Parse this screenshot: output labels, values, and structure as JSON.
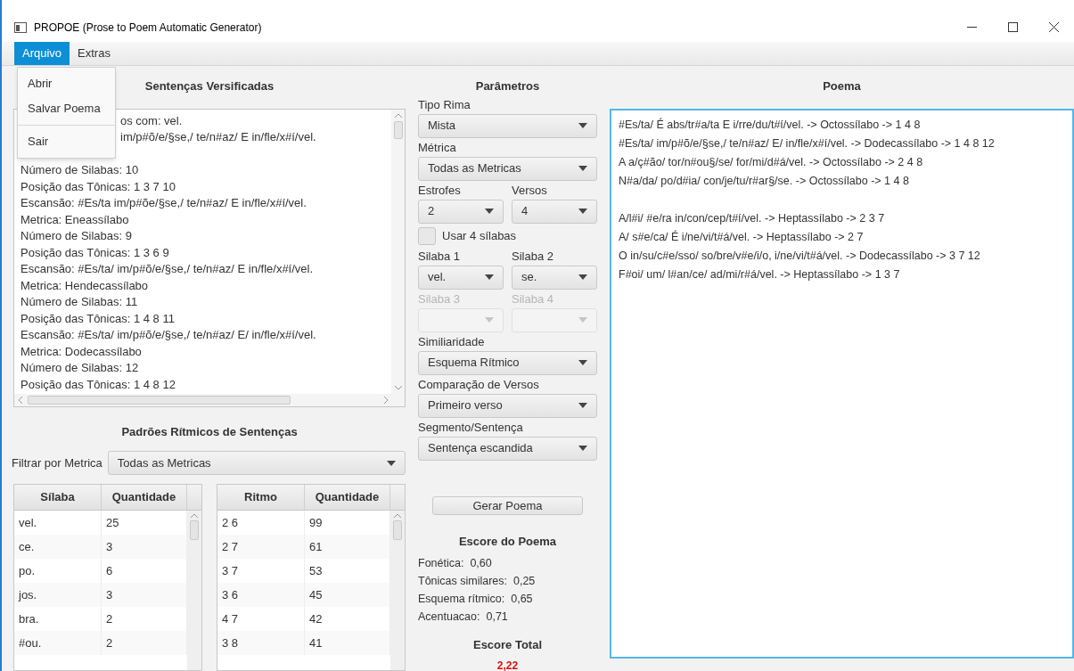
{
  "window": {
    "title": "PROPOE (Prose to Poem Automatic Generator)"
  },
  "menu_bar": [
    {
      "label": "Arquivo",
      "selected": true
    },
    {
      "label": "Extras",
      "selected": false
    }
  ],
  "open_menu": {
    "items": [
      {
        "kind": "item",
        "label": "Abrir"
      },
      {
        "kind": "item",
        "label": "Salvar Poema"
      },
      {
        "kind": "separator"
      },
      {
        "kind": "item",
        "label": "Sair"
      }
    ]
  },
  "verified_sentences": {
    "title": "Sentenças Versificadas",
    "lines": [
      {
        "kind": "partial",
        "text": "os com: vel."
      },
      {
        "kind": "partial",
        "text": "im/p#õ/e/§se,/ te/n#az/ E in/fle/x#í/vel."
      },
      {
        "kind": "covered"
      },
      {
        "kind": "full",
        "text": "Número de Silabas: 10"
      },
      {
        "kind": "full",
        "text": "Posição das Tônicas: 1 3 7 10"
      },
      {
        "kind": "full",
        "text": "Escansão: #Es/ta im/p#õe/§se,/ te/n#az/ E in/fle/x#í/vel."
      },
      {
        "kind": "full",
        "text": "Metrica: Eneassílabo"
      },
      {
        "kind": "full",
        "text": "Número de Silabas: 9"
      },
      {
        "kind": "full",
        "text": "Posição das Tônicas: 1 3 6 9"
      },
      {
        "kind": "full",
        "text": "Escansão: #Es/ta/ im/p#õ/e/§se,/ te/n#az/ E in/fle/x#í/vel."
      },
      {
        "kind": "full",
        "text": "Metrica: Hendecassílabo"
      },
      {
        "kind": "full",
        "text": "Número de Silabas: 11"
      },
      {
        "kind": "full",
        "text": "Posição das Tônicas: 1 4 8 11"
      },
      {
        "kind": "full",
        "text": "Escansão: #Es/ta/ im/p#õ/e/§se,/ te/n#az/ E/ in/fle/x#í/vel."
      },
      {
        "kind": "full",
        "text": "Metrica: Dodecassílabo"
      },
      {
        "kind": "full",
        "text": "Número de Silabas: 12"
      },
      {
        "kind": "full",
        "text": "Posição das Tônicas: 1 4 8 12"
      }
    ]
  },
  "rhythm_patterns": {
    "title": "Padrões Rítmicos de Sentenças",
    "filter": {
      "label": "Filtrar por Metrica",
      "value": "Todas as Metricas"
    },
    "syllable_table": {
      "columns": [
        "Sílaba",
        "Quantidade"
      ],
      "rows": [
        [
          "vel.",
          "25"
        ],
        [
          "ce.",
          "3"
        ],
        [
          "po.",
          "6"
        ],
        [
          "jos.",
          "3"
        ],
        [
          "bra.",
          "2"
        ],
        [
          "#ou.",
          "2"
        ]
      ]
    },
    "rhythm_table": {
      "columns": [
        "Ritmo",
        "Quantidade"
      ],
      "rows": [
        [
          "2 6",
          "99"
        ],
        [
          "2 7",
          "61"
        ],
        [
          "3 7",
          "53"
        ],
        [
          "3 6",
          "45"
        ],
        [
          "4 7",
          "42"
        ],
        [
          "3 8",
          "41"
        ]
      ]
    }
  },
  "parameters": {
    "title": "Parâmetros",
    "fields": [
      {
        "kind": "select",
        "label": "Tipo Rima",
        "value": "Mista",
        "disabled": false
      },
      {
        "kind": "select",
        "label": "Métrica",
        "value": "Todas as Metricas",
        "disabled": false
      },
      {
        "kind": "pair",
        "items": [
          {
            "label": "Estrofes",
            "value": "2",
            "disabled": false
          },
          {
            "label": "Versos",
            "value": "4",
            "disabled": false
          }
        ]
      },
      {
        "kind": "checkbox",
        "label": "Usar 4 sílabas",
        "checked": false
      },
      {
        "kind": "pair",
        "items": [
          {
            "label": "Silaba 1",
            "value": "vel.",
            "disabled": false
          },
          {
            "label": "Silaba 2",
            "value": "se.",
            "disabled": false
          }
        ]
      },
      {
        "kind": "pair",
        "items": [
          {
            "label": "Silaba 3",
            "disabled": true
          },
          {
            "label": "Silaba 4",
            "disabled": true
          }
        ]
      },
      {
        "kind": "select",
        "label": "Similiaridade",
        "value": "Esquema Rítmico",
        "disabled": false
      },
      {
        "kind": "select",
        "label": "Comparação de Versos",
        "value": "Primeiro verso",
        "disabled": false
      },
      {
        "kind": "select",
        "label": "Segmento/Sentença",
        "value": "Sentença escandida",
        "disabled": false
      }
    ],
    "generate_button": "Gerar Poema",
    "score": {
      "title": "Escore do Poema",
      "items": [
        {
          "label": "Fonética:",
          "value": "0,60"
        },
        {
          "label": "Tônicas similares:",
          "value": "0,25"
        },
        {
          "label": "Esquema rítmico:",
          "value": "0,65"
        },
        {
          "label": "Acentuacao:",
          "value": "0,71"
        }
      ],
      "total_title": "Escore Total",
      "total": "2,22"
    }
  },
  "poem": {
    "title": "Poema",
    "stanzas": [
      [
        "#Es/ta/ É abs/tr#a/ta E i/rre/du/t#í/vel. -> Octossílabo -> 1 4 8",
        "#Es/ta/ im/p#õ/e/§se,/ te/n#az/ E/ in/fle/x#í/vel. -> Dodecassílabo -> 1 4 8 12",
        "A a/ç#ão/ tor/n#ou§/se/ for/mi/d#á/vel. -> Octossílabo -> 2 4 8",
        "N#a/da/ po/d#ia/ con/je/tu/r#ar§/se. -> Octossílabo -> 1 4 8"
      ],
      [
        "A/l#i/ #e/ra in/con/cep/t#í/vel. -> Heptassílabo -> 2 3 7",
        "A/ s#e/ca/ É i/ne/vi/t#á/vel. -> Heptassílabo -> 2 7",
        "O in/su/c#e/sso/ so/bre/v#e/i/o, i/ne/vi/t#á/vel. -> Dodecassílabo -> 3 7 12",
        "F#oi/ um/ l#an/ce/ ad/mi/r#á/vel. -> Heptassílabo -> 1 3 7"
      ]
    ]
  }
}
